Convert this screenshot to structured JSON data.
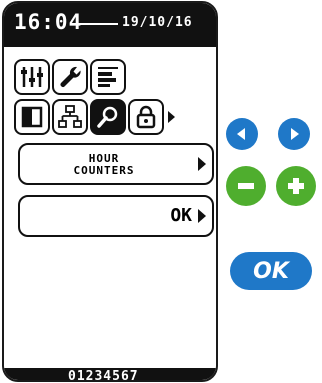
{
  "status_bar": {
    "time": "16:04",
    "date": "19/10/16"
  },
  "icons": {
    "row1": [
      "sliders-icon",
      "wrench-icon",
      "tasks-icon"
    ],
    "row2": [
      "panel-icon",
      "network-icon",
      "search-icon",
      "lock-icon"
    ],
    "selected": "search-icon"
  },
  "menu": {
    "item_label_line1": "HOUR",
    "item_label_line2": "COUNTERS",
    "ok_label": "OK"
  },
  "footer": {
    "serial": "01234567"
  },
  "hardware_buttons": {
    "ok_label": "OK"
  },
  "colors": {
    "blue": "#1f78c8",
    "green": "#4fae2e",
    "screen_dark": "#111111"
  }
}
